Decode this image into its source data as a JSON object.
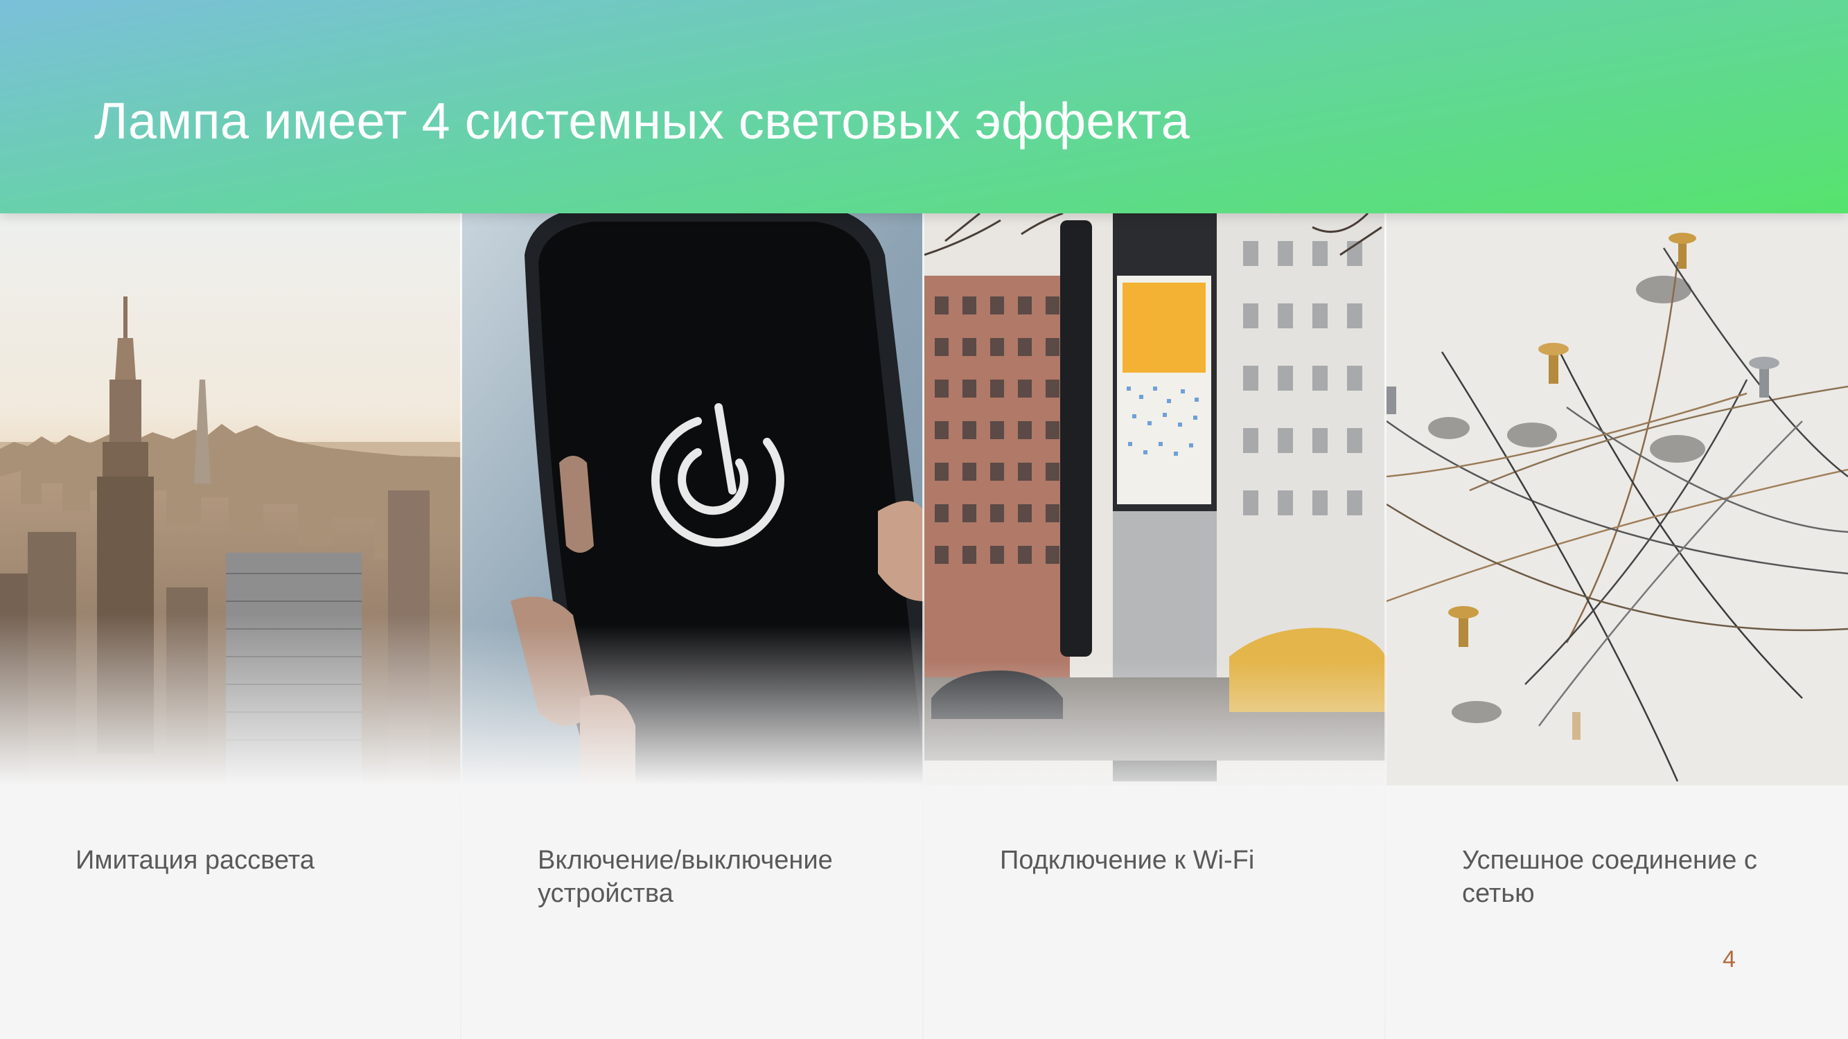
{
  "slide": {
    "title": "Лампа имеет 4 системных световых эффекта",
    "page_number": "4"
  },
  "cards": [
    {
      "caption": "Имитация рассвета",
      "image": "city-skyline-sunrise"
    },
    {
      "caption": "Включение/выключение устройства",
      "image": "smartphone-power-icon"
    },
    {
      "caption": "Подключение к Wi-Fi",
      "image": "linknyc-wifi-kiosk"
    },
    {
      "caption": "Успешное соединение с сетью",
      "image": "pushpins-network"
    }
  ],
  "colors": {
    "header_gradient_start": "#7bbfd9",
    "header_gradient_end": "#56e36d",
    "caption_text": "#595959",
    "page_number": "#b26a3c"
  }
}
